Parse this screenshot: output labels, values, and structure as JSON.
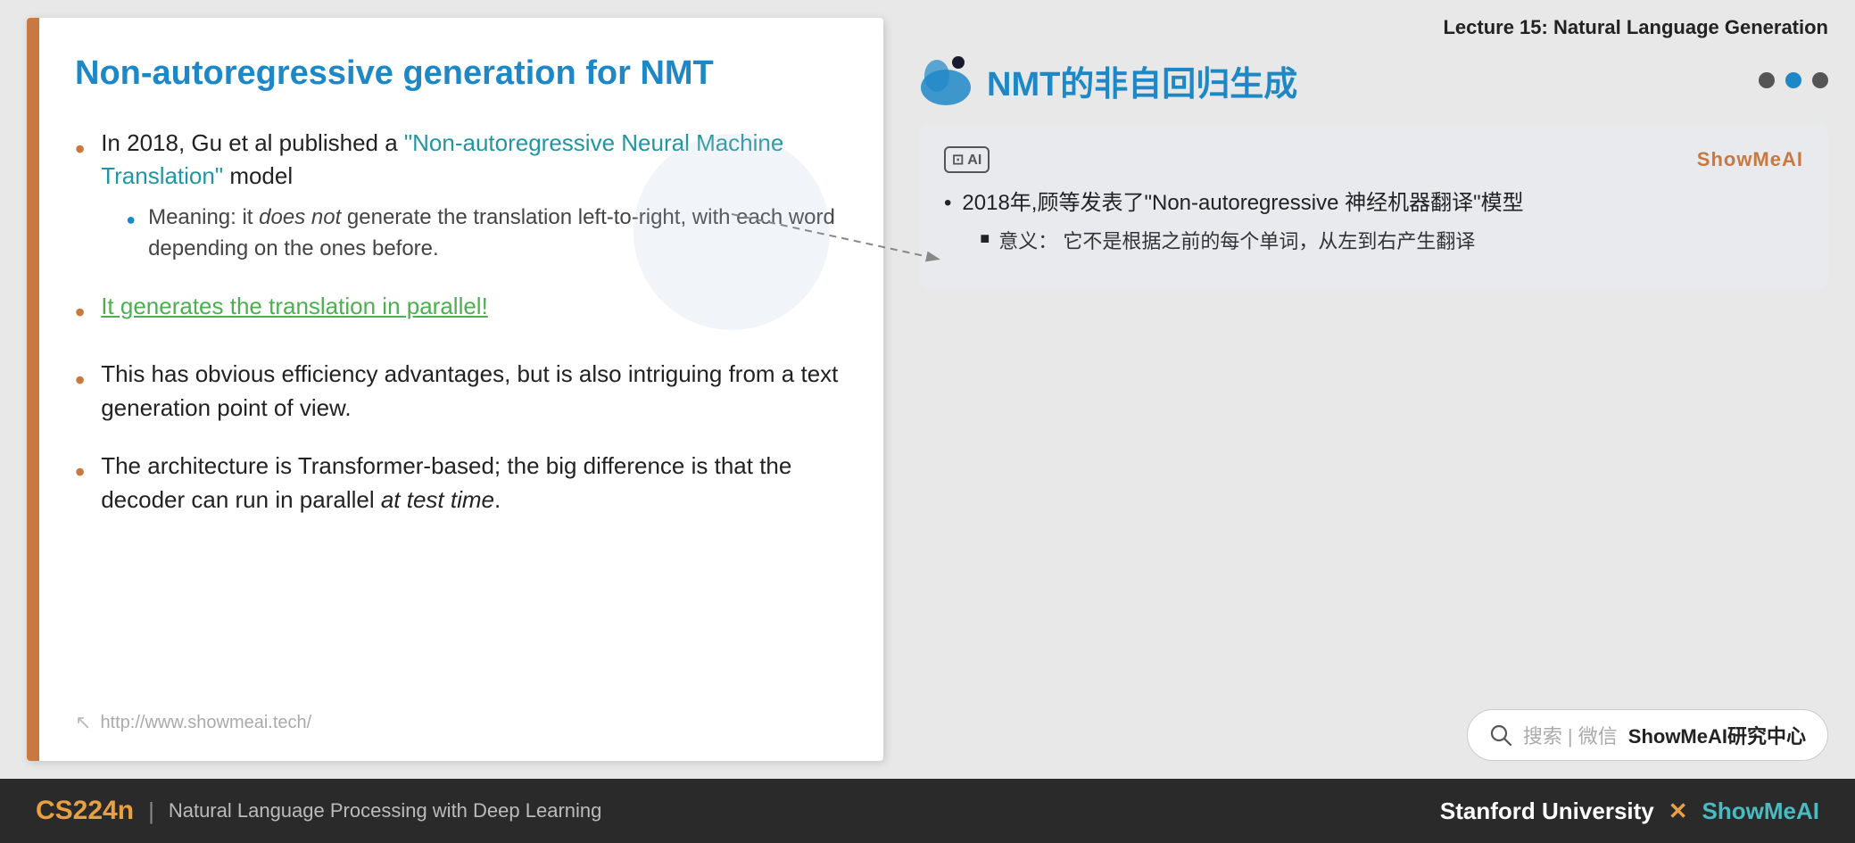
{
  "lecture": {
    "title": "Lecture 15: Natural Language Generation"
  },
  "left_slide": {
    "title": "Non-autoregressive generation for NMT",
    "bullets": [
      {
        "text_before": "In 2018, Gu et al published a ",
        "link_text": "\"Non-autoregressive Neural Machine Translation\"",
        "text_after": " model",
        "sub_bullets": [
          {
            "text": "Meaning: it does not generate the translation left-to-right, with each word depending on the ones before."
          }
        ]
      },
      {
        "link_text": "It generates the translation in parallel!",
        "is_green_link": true
      },
      {
        "text": "This has obvious efficiency advantages, but is also intriguing from a text generation point of view."
      },
      {
        "text_before": "The architecture is Transformer-based; the big difference is that the decoder can run in parallel ",
        "italic_text": "at test time",
        "text_after": "."
      }
    ],
    "footer_url": "http://www.showmeai.tech/"
  },
  "right_slide": {
    "title": "NMT的非自回归生成",
    "nav_dots": [
      {
        "active": false
      },
      {
        "active": true
      },
      {
        "active": false
      }
    ],
    "content_box": {
      "ai_badge": "AI",
      "brand": "ShowMeAI",
      "bullets": [
        {
          "text": "2018年,顾等发表了\"Non-autoregressive  神经机器翻译\"模型",
          "sub_bullets": [
            {
              "text": "意义：  它不是根据之前的每个单词，从左到右产生翻译"
            }
          ]
        }
      ]
    }
  },
  "search_box": {
    "placeholder": "搜索 | 微信 ShowMeAI研究中心"
  },
  "bottom_bar": {
    "course": "CS224n",
    "separator": "|",
    "subtitle": "Natural Language Processing with Deep Learning",
    "university": "Stanford University",
    "x_symbol": "✕",
    "brand": "ShowMeAI"
  }
}
